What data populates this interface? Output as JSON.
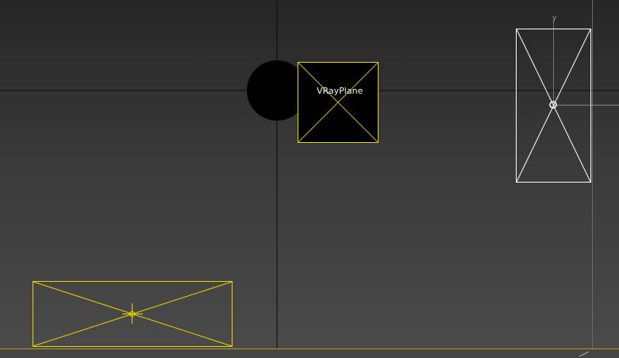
{
  "viewport": {
    "background_top": "#262626",
    "background_bottom": "#4b4b4b",
    "grid_line_color": "#0a0a0a",
    "selection_color": "#ffea00",
    "unselected_wire_color": "#ffffff",
    "bottom_edge_color": "#b59a1c"
  },
  "objects": {
    "vray_plane": {
      "label": "VRayPlane"
    },
    "light_gizmo": {
      "axis_label": "y"
    }
  }
}
